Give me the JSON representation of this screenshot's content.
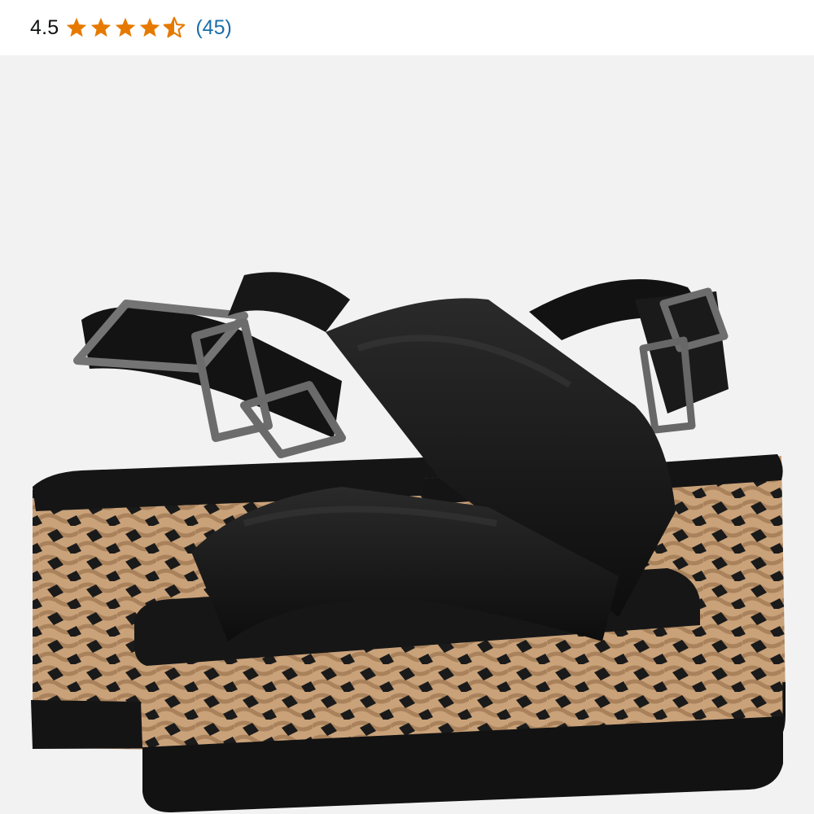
{
  "rating": {
    "value": "4.5",
    "stars": 4.5,
    "max_stars": 5,
    "review_count": "(45)",
    "star_color": "#e67a00",
    "link_color": "#1b6fa8"
  },
  "product_image": {
    "icon": "sandal-product-photo",
    "background_color": "#f2f2f2",
    "strap_color": "#111111",
    "raffia_colors": [
      "#c9a27a",
      "#1a1a1a"
    ]
  }
}
